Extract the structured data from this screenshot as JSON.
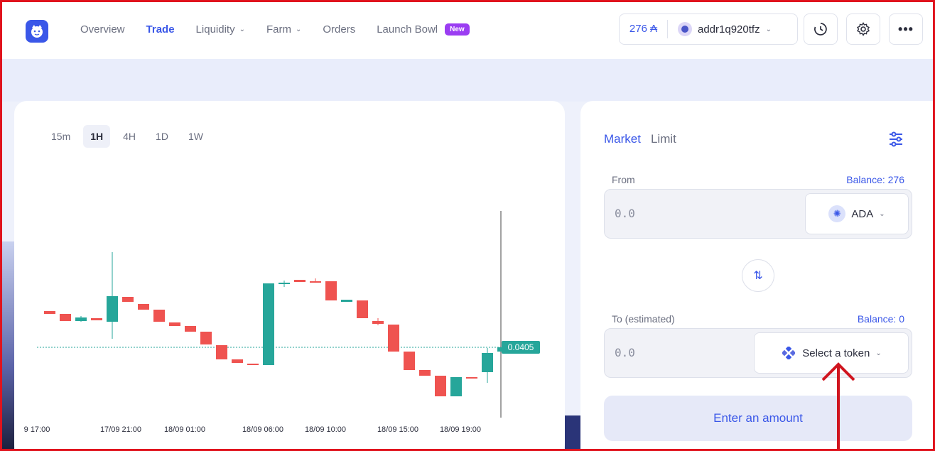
{
  "nav": {
    "items": [
      {
        "label": "Overview",
        "dropdown": false,
        "active": false
      },
      {
        "label": "Trade",
        "dropdown": false,
        "active": true
      },
      {
        "label": "Liquidity",
        "dropdown": true,
        "active": false
      },
      {
        "label": "Farm",
        "dropdown": true,
        "active": false
      },
      {
        "label": "Orders",
        "dropdown": false,
        "active": false
      },
      {
        "label": "Launch Bowl",
        "dropdown": false,
        "active": false
      }
    ],
    "new_badge": "New"
  },
  "wallet": {
    "balance": "276 ₳",
    "address": "addr1q920tfz"
  },
  "timeframes": [
    {
      "label": "15m",
      "active": false
    },
    {
      "label": "1H",
      "active": true
    },
    {
      "label": "4H",
      "active": false
    },
    {
      "label": "1D",
      "active": false
    },
    {
      "label": "1W",
      "active": false
    }
  ],
  "chart_data": {
    "type": "candlestick",
    "x_tick_labels": [
      "9 17:00",
      "17/09 21:00",
      "18/09 01:00",
      "18/09 06:00",
      "18/09 10:00",
      "18/09 15:00",
      "18/09 19:00"
    ],
    "last_price_label": "0.0405",
    "colors": {
      "up": "#26a69a",
      "down": "#ef5350"
    }
  },
  "swap": {
    "tab_market": "Market",
    "tab_limit": "Limit",
    "from_label": "From",
    "from_balance": "Balance: 276",
    "from_amount": "0.0",
    "from_token": "ADA",
    "to_label": "To (estimated)",
    "to_balance": "Balance: 0",
    "to_amount": "0.0",
    "to_token": "Select a token",
    "cta": "Enter an amount"
  }
}
